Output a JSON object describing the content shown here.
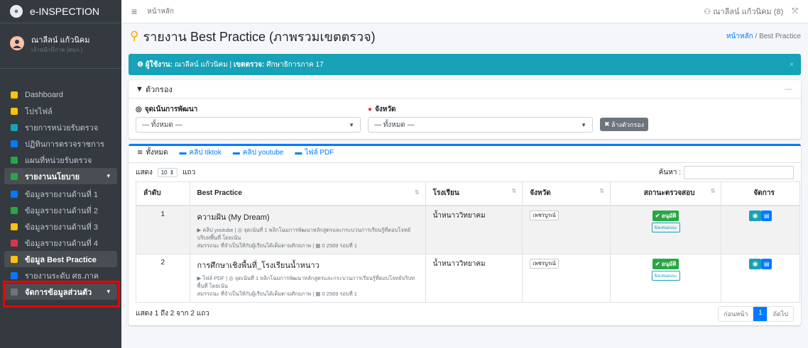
{
  "brand": "e-INSPECTION",
  "user": {
    "name": "ณาลีลน์ แก้วนิคม",
    "role": "เจ้าหน้าที่ภาค (ศธภ.)"
  },
  "nav": [
    {
      "label": "Dashboard",
      "icon": "dashboard-icon",
      "color": "#ffc107"
    },
    {
      "label": "โปรไฟล์",
      "icon": "user-icon",
      "color": "#ffc107"
    },
    {
      "label": "รายการหน่วยรับตรวจ",
      "icon": "list-icon",
      "color": "#17a2b8"
    },
    {
      "label": "ปฏิทินการตรวจราชการ",
      "icon": "calendar-icon",
      "color": "#007bff"
    },
    {
      "label": "แผนที่หน่วยรับตรวจ",
      "icon": "map-icon",
      "color": "#28a745"
    },
    {
      "label": "รายงานนโยบาย",
      "icon": "report-icon",
      "color": "#28a745",
      "open": true
    },
    {
      "label": "ข้อมูลรายงานด้านที่ 1",
      "icon": "file-icon",
      "color": "#007bff"
    },
    {
      "label": "ข้อมูลรายงานด้านที่ 2",
      "icon": "file-icon",
      "color": "#28a745"
    },
    {
      "label": "ข้อมูลรายงานด้านที่ 3",
      "icon": "file-icon",
      "color": "#ffc107"
    },
    {
      "label": "ข้อมูลรายงานด้านที่ 4",
      "icon": "file-icon",
      "color": "#dc3545"
    },
    {
      "label": "ข้อมูล Best Practice",
      "icon": "medal-icon",
      "color": "#ffc107",
      "active": true
    },
    {
      "label": "รายงานระดับ ศธ.ภาค",
      "icon": "chart-icon",
      "color": "#007bff"
    },
    {
      "label": "จัดการข้อมูลส่วนตัว",
      "icon": "cog-icon",
      "color": "#6c757d",
      "open": true
    }
  ],
  "topbar": {
    "home": "หน้าหลัก",
    "user": "ณาลีลน์ แก้วนิคม (8)"
  },
  "page": {
    "title": "รายงาน Best Practice (ภาพรวมเขตตรวจ)",
    "crumb_home": "หน้าหลัก",
    "crumb_current": "Best Practice"
  },
  "alert": {
    "user_label": "ผู้ใช้งาน:",
    "user": "ณาลีลน์ แก้วนิคม",
    "zone_label": "เขตตรวจ:",
    "zone": "ศึกษาธิการภาค 17"
  },
  "filter": {
    "title": "ตัวกรอง",
    "focus_label": "จุดเน้นการพัฒนา",
    "focus_value": "— ทั้งหมด —",
    "province_label": "จังหวัด",
    "province_value": "— ทั้งหมด —",
    "clear": "ล้างตัวกรอง"
  },
  "tabs": [
    "ทั้งหมด",
    "คลิป tiktok",
    "คลิป youtube",
    "ไฟล์ PDF"
  ],
  "table_toolbar": {
    "show": "แสดง",
    "length": "10",
    "rows": "แถว",
    "search": "ค้นหา :"
  },
  "columns": [
    "ลำดับ",
    "Best Practice",
    "โรงเรียน",
    "จังหวัด",
    "สถานะตรวจสอบ",
    "จัดการ"
  ],
  "rows": [
    {
      "no": "1",
      "title": "ความฝัน (My Dream)",
      "meta1": "คลิป youtube  |  ◎ จุดเน้นที่ 1 พลิกโฉมการพัฒนาหลักสูตรและกระบวนการเรียนรู้ที่ตอบโจทย์บริบทพื้นที่ โดยเน้น",
      "meta2": "สมรรถนะ ที่จำเป็นให้กับผู้เรียนได้เต็มตามศักยภาพ  |  ▦ 0 2569 รอบที่ 1",
      "school": "น้ำหนาววิทยาคม",
      "province": "เพชรบูรณ์",
      "status": "อนุมัติ",
      "feedback": "ข้อเสนอแนะ"
    },
    {
      "no": "2",
      "title": "การศึกษาเชิงพื้นที่_โรงเรียนน้ำหนาว",
      "meta1": "ไฟล์ PDF  |  ◎ จุดเน้นที่ 1 พลิกโฉมการพัฒนาหลักสูตรและกระบวนการเรียนรู้ที่ตอบโจทย์บริบทพื้นที่ โดยเน้น",
      "meta2": "สมรรถนะ ที่จำเป็นให้กับผู้เรียนได้เต็มตามศักยภาพ  |  ▦ 0 2569 รอบที่ 1",
      "school": "น้ำหนาววิทยาคม",
      "province": "เพชรบูรณ์",
      "status": "อนุมัติ",
      "feedback": "ข้อเสนอแนะ"
    }
  ],
  "footer": {
    "info": "แสดง 1 ถึง 2 จาก 2 แถว",
    "prev": "ก่อนหน้า",
    "page": "1",
    "next": "ถัดไป"
  }
}
